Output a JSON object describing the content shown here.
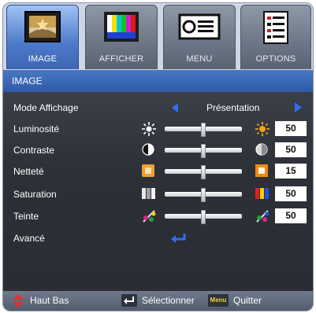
{
  "tabs": [
    {
      "label": "IMAGE",
      "icon": "image-picture-icon",
      "active": true
    },
    {
      "label": "AFFICHER",
      "icon": "display-color-bars-icon",
      "active": false
    },
    {
      "label": "MENU",
      "icon": "projector-menu-icon",
      "active": false
    },
    {
      "label": "OPTIONS",
      "icon": "options-list-icon",
      "active": false
    }
  ],
  "header": {
    "title": "IMAGE"
  },
  "mode": {
    "label": "Mode Affichage",
    "value": "Présentation"
  },
  "rows": [
    {
      "label": "Luminosité",
      "value": "50",
      "level": 0.5
    },
    {
      "label": "Contraste",
      "value": "50",
      "level": 0.5
    },
    {
      "label": "Netteté",
      "value": "15",
      "level": 0.5
    },
    {
      "label": "Saturation",
      "value": "50",
      "level": 0.5
    },
    {
      "label": "Teinte",
      "value": "50",
      "level": 0.5
    }
  ],
  "advanced": {
    "label": "Avancé"
  },
  "footer": {
    "nav": "Haut Bas",
    "select": "Sélectionner",
    "menu_key": "Menu",
    "quit": "Quitter"
  },
  "colors": {
    "accent": "#3d6fd0",
    "arrow": "#2f6df0",
    "panel": "#2d3037"
  }
}
